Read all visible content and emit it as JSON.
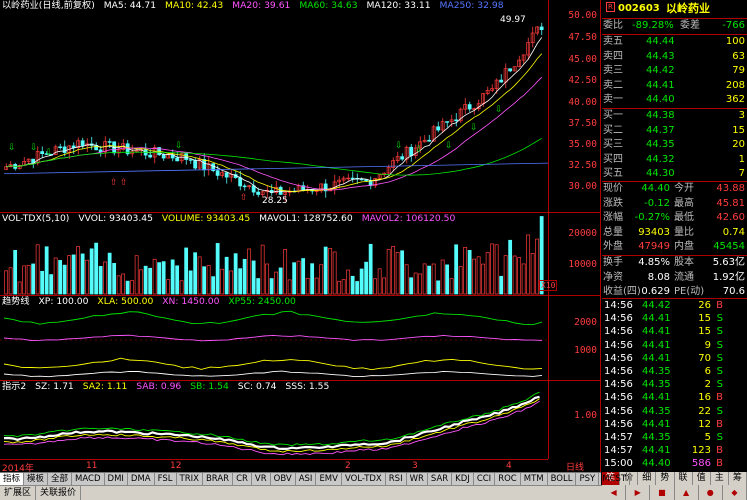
{
  "price_header": {
    "title": "以岭药业(日线,前复权)",
    "ma5": "MA5: 44.71",
    "ma10": "MA10: 42.43",
    "ma20": "MA20: 39.61",
    "ma60": "MA60: 34.63",
    "ma120": "MA120: 33.11",
    "ma250": "MA250: 32.98"
  },
  "price_axis": [
    "50.00",
    "47.50",
    "45.00",
    "42.50",
    "40.00",
    "37.50",
    "35.00",
    "32.50",
    "30.00"
  ],
  "price_annotations": {
    "high": "49.97",
    "low": "28.25"
  },
  "vol_header": {
    "title": "VOL-TDX(5,10)",
    "vvol": "VVOL: 93403.45",
    "volume": "VOLUME: 93403.45",
    "mavol1": "MAVOL1: 128752.60",
    "mavol2": "MAVOL2: 106120.50"
  },
  "vol_axis": [
    "20000",
    "10000"
  ],
  "vol_unit": "X10",
  "trend_header": {
    "title": "趋势线",
    "xp": "XP: 100.00",
    "xla": "XLA: 500.00",
    "xn": "XN: 1450.00",
    "xp55": "XP55: 2450.00"
  },
  "trend_axis": [
    "2000",
    "1000"
  ],
  "ind2_header": {
    "title": "指示2",
    "sz": "SZ: 1.71",
    "sa2": "SA2: 1.11",
    "sab": "SAB: 0.96",
    "sb": "SB: 1.54",
    "sc": "SC: 0.74",
    "sss": "SSS: 1.55"
  },
  "ind2_axis": [
    "1.00"
  ],
  "x_axis": [
    "2014年",
    "11",
    "12",
    "2",
    "3",
    "4"
  ],
  "x_axis_right": "日线",
  "bottom_tabs": [
    "指标",
    "模板",
    "全部",
    "MACD",
    "DMI",
    "DMA",
    "FSL",
    "TRIX",
    "BRAR",
    "CR",
    "VR",
    "OBV",
    "ASI",
    "EMV",
    "VOL-TDX",
    "RSI",
    "WR",
    "SAR",
    "KDJ",
    "CCI",
    "ROC",
    "MTM",
    "BOLL",
    "PSY",
    "MCST"
  ],
  "status_tabs": [
    "扩展区",
    "关联报价"
  ],
  "quote": {
    "code": "002603",
    "name": "以岭药业",
    "badge": "R",
    "weibi_label": "委比",
    "weibi": "-89.28%",
    "weicha_label": "委差",
    "weicha": "-766",
    "asks": [
      {
        "label": "卖五",
        "price": "44.44",
        "vol": "100"
      },
      {
        "label": "卖四",
        "price": "44.43",
        "vol": "63"
      },
      {
        "label": "卖三",
        "price": "44.42",
        "vol": "79"
      },
      {
        "label": "卖二",
        "price": "44.41",
        "vol": "208"
      },
      {
        "label": "卖一",
        "price": "44.40",
        "vol": "362"
      }
    ],
    "bids": [
      {
        "label": "买一",
        "price": "44.38",
        "vol": "3"
      },
      {
        "label": "买二",
        "price": "44.37",
        "vol": "15"
      },
      {
        "label": "买三",
        "price": "44.35",
        "vol": "20"
      },
      {
        "label": "买四",
        "price": "44.32",
        "vol": "1"
      },
      {
        "label": "买五",
        "price": "44.30",
        "vol": "7"
      }
    ],
    "stats": [
      {
        "l1": "现价",
        "v1": "44.40",
        "l2": "今开",
        "v2": "43.88"
      },
      {
        "l1": "涨跌",
        "v1": "-0.12",
        "l2": "最高",
        "v2": "45.81"
      },
      {
        "l1": "涨幅",
        "v1": "-0.27%",
        "l2": "最低",
        "v2": "42.60"
      },
      {
        "l1": "总量",
        "v1": "93403",
        "l2": "量比",
        "v2": "0.74"
      },
      {
        "l1": "外盘",
        "v1": "47949",
        "l2": "内盘",
        "v2": "45454"
      }
    ],
    "stats2": [
      {
        "l1": "换手",
        "v1": "4.85%",
        "l2": "股本",
        "v2": "5.63亿"
      },
      {
        "l1": "净资",
        "v1": "8.08",
        "l2": "流通",
        "v2": "1.92亿"
      },
      {
        "l1": "收益(四)",
        "v1": "0.629",
        "l2": "PE(动)",
        "v2": "70.6"
      }
    ],
    "ticks": [
      {
        "time": "14:56",
        "price": "44.42",
        "vol": "26",
        "side": "B"
      },
      {
        "time": "14:56",
        "price": "44.41",
        "vol": "15",
        "side": "S"
      },
      {
        "time": "14:56",
        "price": "44.41",
        "vol": "15",
        "side": "S"
      },
      {
        "time": "14:56",
        "price": "44.41",
        "vol": "9",
        "side": "S"
      },
      {
        "time": "14:56",
        "price": "44.41",
        "vol": "70",
        "side": "S"
      },
      {
        "time": "14:56",
        "price": "44.35",
        "vol": "6",
        "side": "S"
      },
      {
        "time": "14:56",
        "price": "44.35",
        "vol": "2",
        "side": "S"
      },
      {
        "time": "14:56",
        "price": "44.41",
        "vol": "16",
        "side": "B"
      },
      {
        "time": "14:56",
        "price": "44.35",
        "vol": "22",
        "side": "S"
      },
      {
        "time": "14:56",
        "price": "44.41",
        "vol": "12",
        "side": "B"
      },
      {
        "time": "14:57",
        "price": "44.35",
        "vol": "5",
        "side": "S"
      },
      {
        "time": "14:57",
        "price": "44.41",
        "vol": "123",
        "side": "B"
      },
      {
        "time": "15:00",
        "price": "44.40",
        "vol": "586",
        "side": "B"
      }
    ]
  },
  "right_tabs": [
    "笔",
    "价",
    "细",
    "势",
    "联",
    "值",
    "主",
    "筹"
  ],
  "bottom_right_icons": [
    "◀",
    "▶",
    "■",
    "▲",
    "●",
    "◆"
  ]
}
